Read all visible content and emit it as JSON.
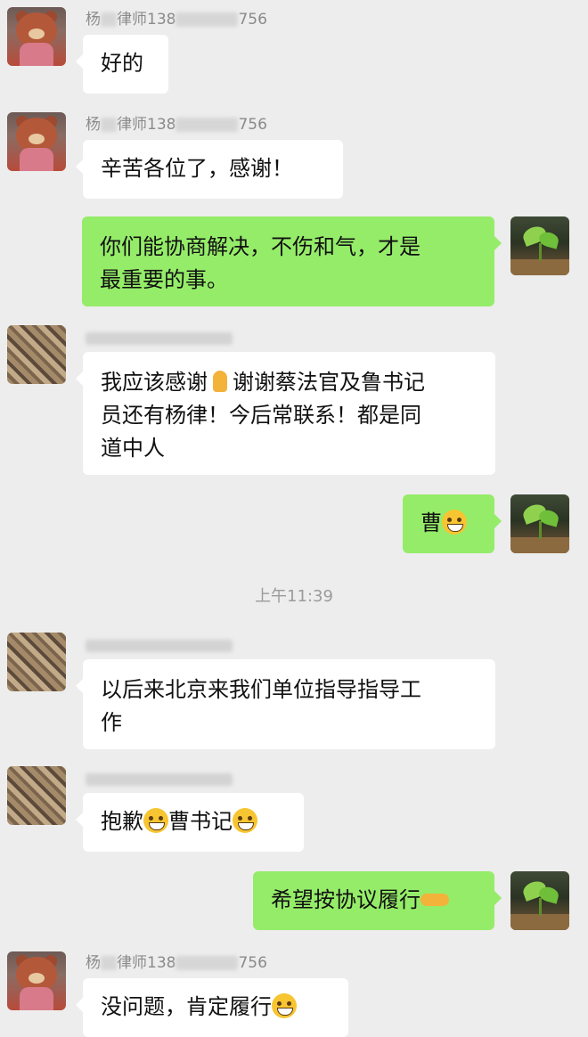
{
  "chat": {
    "time_divider": "上午11:39",
    "messages": [
      {
        "side": "left",
        "avatar": "bear-avatar",
        "sender": "杨律师138…756",
        "text": "好的"
      },
      {
        "side": "left",
        "avatar": "bear-avatar",
        "sender": "杨律师138…756",
        "text": "辛苦各位了，感谢！"
      },
      {
        "side": "right",
        "avatar": "plant-avatar",
        "text_line1": "你们能协商解决，不伤和气，才是",
        "text_line2": "最重要的事。"
      },
      {
        "side": "left",
        "avatar": "cork-avatar",
        "text_line1": "我应该感谢",
        "text_line1b": "谢谢蔡法官及鲁书记",
        "text_line2": "员还有杨律！今后常联系！都是同",
        "text_line3": "道中人"
      },
      {
        "side": "right",
        "avatar": "plant-avatar",
        "text": "曹"
      },
      {
        "side": "left",
        "avatar": "cork-avatar",
        "text_line1": "以后来北京来我们单位指导指导工",
        "text_line2": "作"
      },
      {
        "side": "left",
        "avatar": "cork-avatar",
        "text_a": "抱歉",
        "text_b": "曹书记"
      },
      {
        "side": "right",
        "avatar": "plant-avatar",
        "text": "希望按协议履行"
      },
      {
        "side": "left",
        "avatar": "bear-avatar",
        "sender": "杨律师138…756",
        "text": "没问题，肯定履行"
      }
    ],
    "sender_name": {
      "prefix": "杨",
      "mid": "律师138",
      "suffix": "756"
    },
    "emojis": {
      "pray": "pray-emoji",
      "laugh": "laugh-emoji",
      "think": "think-emoji",
      "grin": "grin-emoji",
      "handshake": "handshake-emoji"
    }
  }
}
